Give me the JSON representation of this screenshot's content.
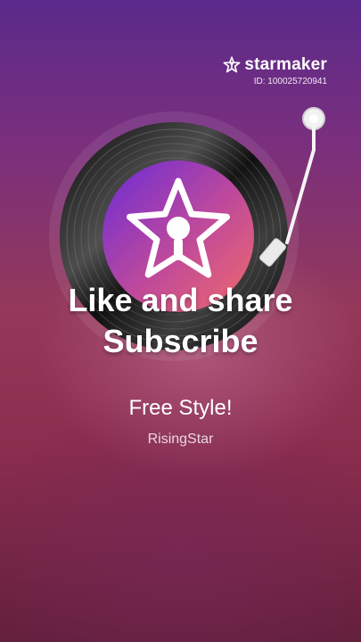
{
  "brand": {
    "name": "starmaker",
    "id_label": "ID: 100025720941",
    "logo_icon": "starmaker-logo-icon"
  },
  "overlay": {
    "line1": "Like and share",
    "line2": "Subscribe"
  },
  "song": {
    "title": "Free Style!",
    "artist": "RisingStar"
  },
  "colors": {
    "label_gradient_start": "#6a2bd8",
    "label_gradient_end": "#f06a6a",
    "vinyl": "#1b1b1b"
  }
}
